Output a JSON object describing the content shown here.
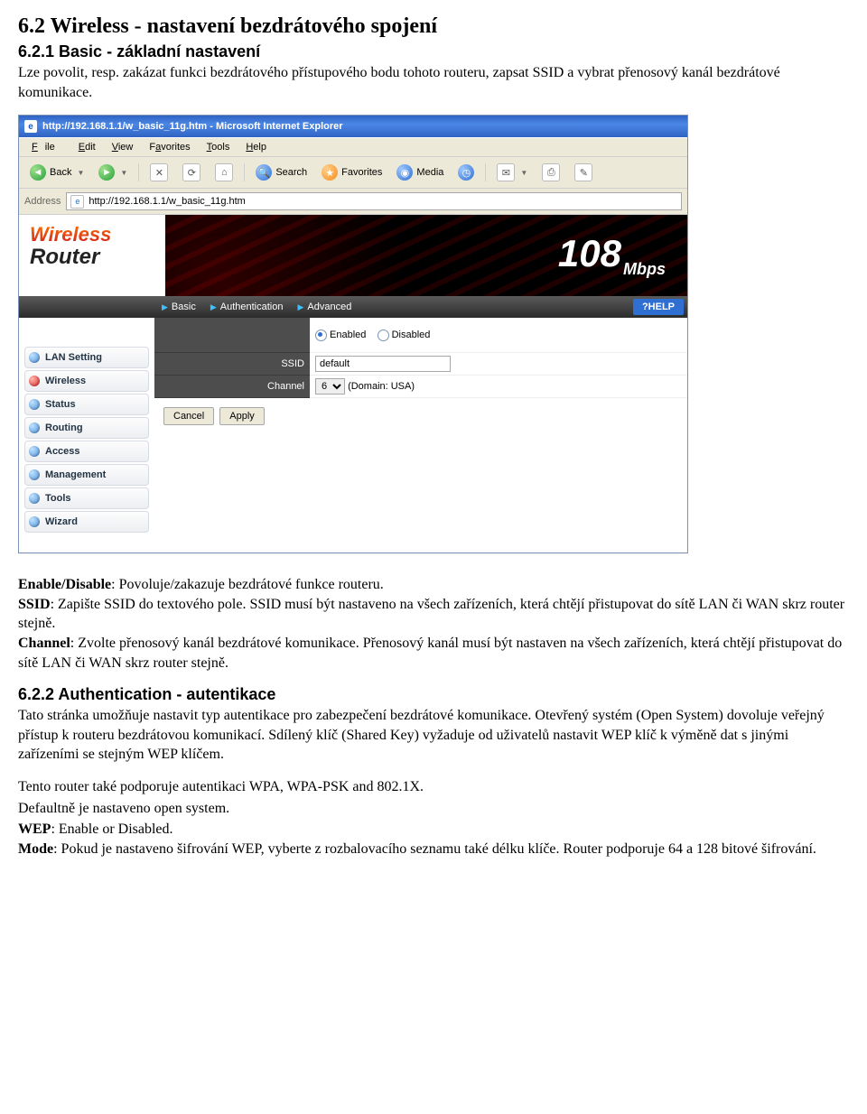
{
  "section": {
    "h62": "6.2 Wireless - nastavení bezdrátového spojení",
    "h621": "6.2.1 Basic - základní nastavení",
    "p621": "Lze povolit, resp. zakázat funkci bezdrátového přístupového bodu tohoto routeru, zapsat SSID a vybrat přenosový kanál bezdrátové komunikace.",
    "term_enable": "Enable/Disable",
    "desc_enable": ": Povoluje/zakazuje bezdrátové funkce routeru.",
    "term_ssid": "SSID",
    "desc_ssid": ": Zapište SSID do textového pole. SSID musí být nastaveno na všech zařízeních, která chtějí přistupovat do sítě LAN či WAN skrz router stejně.",
    "term_channel": "Channel",
    "desc_channel": ": Zvolte přenosový kanál bezdrátové komunikace. Přenosový kanál musí být nastaven na všech zařízeních, která chtějí přistupovat do sítě LAN či WAN skrz router stejně.",
    "h622": "6.2.2 Authentication - autentikace",
    "p622a": "Tato stránka umožňuje nastavit typ autentikace pro zabezpečení bezdrátové komunikace. Otevřený systém (Open System) dovoluje veřejný přístup k routeru bezdrátovou komunikací. Sdílený klíč (Shared Key) vyžaduje od uživatelů nastavit WEP klíč k výměně dat s jinými zařízeními se stejným WEP klíčem.",
    "p622b": "Tento router také podporuje autentikaci WPA, WPA-PSK and 802.1X.",
    "p622c": "Defaultně je nastaveno open system.",
    "term_wep": "WEP",
    "desc_wep": ": Enable or Disabled.",
    "term_mode": "Mode",
    "desc_mode": ": Pokud je nastaveno šifrování WEP, vyberte z rozbalovacího seznamu také délku klíče. Router podporuje 64 a 128 bitové šifrování."
  },
  "ie": {
    "title": "http://192.168.1.1/w_basic_11g.htm - Microsoft Internet Explorer",
    "menu": {
      "file": "File",
      "edit": "Edit",
      "view": "View",
      "favorites": "Favorites",
      "tools": "Tools",
      "help": "Help"
    },
    "tb": {
      "back": "Back",
      "search": "Search",
      "favorites": "Favorites",
      "media": "Media"
    },
    "addr_label": "Address",
    "url": "http://192.168.1.1/w_basic_11g.htm"
  },
  "banner": {
    "wireless": "Wireless",
    "router": "Router",
    "mbps": "108",
    "mbps_unit": "Mbps"
  },
  "tabs": {
    "basic": "Basic",
    "auth": "Authentication",
    "adv": "Advanced",
    "help": "?HELP"
  },
  "sidebar": {
    "items": [
      {
        "label": "LAN Setting"
      },
      {
        "label": "Wireless"
      },
      {
        "label": "Status"
      },
      {
        "label": "Routing"
      },
      {
        "label": "Access"
      },
      {
        "label": "Management"
      },
      {
        "label": "Tools"
      },
      {
        "label": "Wizard"
      }
    ]
  },
  "form": {
    "enabled": "Enabled",
    "disabled": "Disabled",
    "state": "enabled",
    "ssid_label": "SSID",
    "ssid_value": "default",
    "channel_label": "Channel",
    "channel_value": "6",
    "channel_domain": "(Domain: USA)",
    "cancel": "Cancel",
    "apply": "Apply"
  }
}
